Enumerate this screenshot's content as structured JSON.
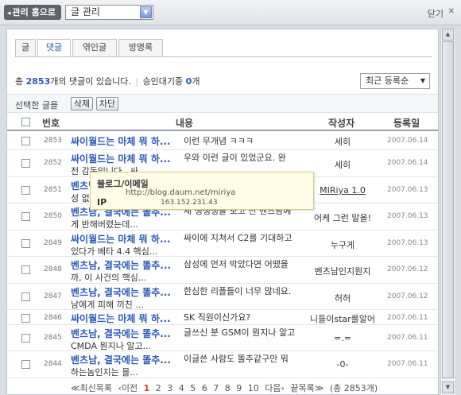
{
  "topbar": {
    "home_label": "관리 홈으로",
    "home_arrow": "◂",
    "select_value": "글 관리",
    "close_label": "닫기",
    "close_icon": "✕"
  },
  "tabs": [
    {
      "label": "글",
      "active": false
    },
    {
      "label": "댓글",
      "active": true
    },
    {
      "label": "엮인글",
      "active": false
    },
    {
      "label": "방명록",
      "active": false
    }
  ],
  "summary": {
    "prefix": "총",
    "count": "2853",
    "suffix": "개의 댓글이 있습니다.",
    "pending_label": "승인대기중",
    "pending_count": "0",
    "pending_unit": "개",
    "sort_value": "최근 등록순"
  },
  "actions": {
    "label": "선택한 글을",
    "delete": "삭제",
    "block": "차단"
  },
  "table": {
    "headers": {
      "num": "번호",
      "content": "내용",
      "author": "작성자",
      "date": "등록일"
    },
    "rows": [
      {
        "num": "2853",
        "title": "싸이월드는 마체 뭐 하...",
        "line1": "이런 무개념 ㅋㅋㅋ",
        "line2": "",
        "author": "세히",
        "date": "2007.06.14"
      },
      {
        "num": "2852",
        "title": "싸이월드는 마체 뭐 하...",
        "line1": "우와 이런 글이 있었군요. 완",
        "line2": "전 감동입니다.. 싸...",
        "author": "세히",
        "date": "2007.06.14"
      },
      {
        "num": "2851",
        "title": "벤츠남",
        "line1": "",
        "line2": "성 없",
        "author": "MIRiya 1.0",
        "date": "2007.06.13"
      },
      {
        "num": "2850",
        "title": "벤츠남, 결국에는 똘추...",
        "line1": "제 생생생을 보고 전 벤츠남에",
        "line2": "게 반해버렸는데...",
        "author": "어케 그런 말을!",
        "date": "2007.06.13"
      },
      {
        "num": "2849",
        "title": "싸이월드는 마체 뭐 하...",
        "line1": "싸이에 지쳐서 C2를 기대하고",
        "line2": "있다가 베타 4.4 핵심...",
        "author": "누구게",
        "date": "2007.06.13"
      },
      {
        "num": "2848",
        "title": "벤츠남, 결국에는 똘추...",
        "line1": "삼성에 먼저 박았다면 어땠을",
        "line2": "까, 이 사건의 핵심...",
        "author": "벤츠남인지뭔지",
        "date": "2007.06.12"
      },
      {
        "num": "2847",
        "title": "벤츠남, 결국에는 똘추...",
        "line1": "한심한 리플들이 너무 많네요.",
        "line2": "남에게 피해 끼친 ...",
        "author": "허허",
        "date": "2007.06.12"
      },
      {
        "num": "2846",
        "title": "싸이월드는 마체 뭐 하...",
        "line1": "SK 직원이신가요?",
        "line2": "",
        "author": "니들이star를알어",
        "date": "2007.06.11"
      },
      {
        "num": "2845",
        "title": "벤츠남, 결국에는 똘추...",
        "line1": "글쓰신 분 GSM이 뭔지나 알고",
        "line2": "CMDA 뭔지나 알고...",
        "author": "=.=",
        "date": "2007.06.11"
      },
      {
        "num": "2844",
        "title": "벤츠남, 결국에는 똘추...",
        "line1": "이글쓴 사람도 똘추같구만 뭐",
        "line2": "하는놈인지는 몰...",
        "author": "-0-",
        "date": "2007.06.11"
      }
    ]
  },
  "pager": {
    "first": "≪최신목록",
    "prev": "‹이전",
    "pages": [
      "1",
      "2",
      "3",
      "4",
      "5",
      "6",
      "7",
      "8",
      "9",
      "10"
    ],
    "current": "1",
    "next": "다음›",
    "last": "끝목록≫",
    "total": "(총 2853개)"
  },
  "tooltip": {
    "title": "블로그/이메일",
    "url": "http://blog.daum.net/miriya",
    "ip_label": "IP",
    "ip": "163.152.231.43"
  }
}
